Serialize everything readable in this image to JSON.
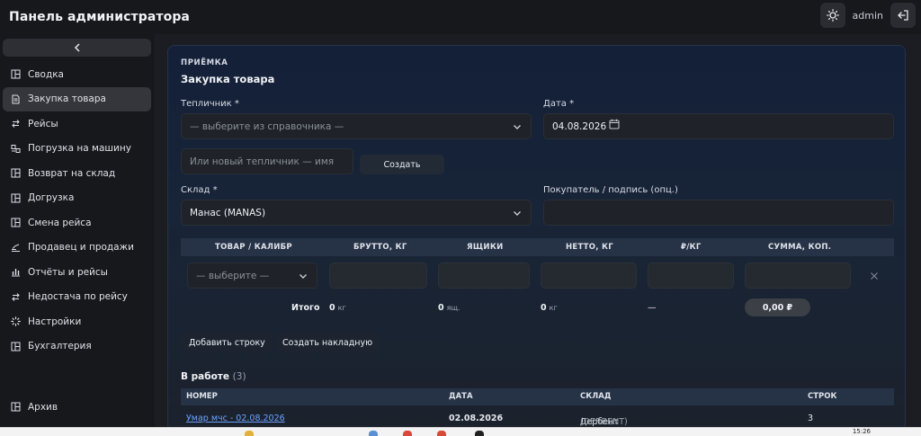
{
  "header": {
    "title": "Панель администратора",
    "user": "admin",
    "theme_icon": "sun-icon",
    "logout_icon": "logout-icon"
  },
  "sidebar": {
    "collapse_icon": "chevron-left-icon",
    "items": [
      {
        "label": "Сводка",
        "icon": "layout-icon",
        "active": false
      },
      {
        "label": "Закупка товара",
        "icon": "document-icon",
        "active": true
      },
      {
        "label": "Рейсы",
        "icon": "swap-icon",
        "active": false
      },
      {
        "label": "Погрузка на машину",
        "icon": "truck-load-icon",
        "active": false
      },
      {
        "label": "Возврат на склад",
        "icon": "layout-icon",
        "active": false
      },
      {
        "label": "Догрузка",
        "icon": "layout-icon",
        "active": false
      },
      {
        "label": "Смена рейса",
        "icon": "layout-icon",
        "active": false
      },
      {
        "label": "Продавец и продажи",
        "icon": "scale-icon",
        "active": false
      },
      {
        "label": "Отчёты и рейсы",
        "icon": "bar-chart-icon",
        "active": false
      },
      {
        "label": "Недостача по рейсу",
        "icon": "swap-icon",
        "active": false
      },
      {
        "label": "Настройки",
        "icon": "settings-icon",
        "active": false
      },
      {
        "label": "Бухгалтерия",
        "icon": "layout-icon",
        "active": false
      }
    ],
    "archive": {
      "label": "Архив",
      "icon": "layout-icon"
    }
  },
  "form": {
    "eyebrow": "ПРИЁМКА",
    "title": "Закупка товара",
    "greenhouse_label": "Тепличник *",
    "greenhouse_placeholder": "— выберите из справочника —",
    "date_label": "Дата *",
    "date_value": "04.08.2026",
    "new_greenhouse_placeholder": "Или новый тепличник — имя",
    "create_button": "Создать",
    "warehouse_label": "Склад *",
    "warehouse_value": "Манас (MANAS)",
    "buyer_label": "Покупатель / подпись (опц.)",
    "buyer_value": ""
  },
  "items_table": {
    "columns": [
      "ТОВАР / КАЛИБР",
      "БРУТТО, КГ",
      "ЯЩИКИ",
      "НЕТТО, КГ",
      "₽/КГ",
      "СУММА, КОП."
    ],
    "row_select_placeholder": "— выберите —",
    "total_label": "Итого",
    "total_gross": "0",
    "total_gross_unit": "кг",
    "total_boxes": "0",
    "total_boxes_unit": "ящ.",
    "total_net": "0",
    "total_net_unit": "кг",
    "total_price": "—",
    "total_sum": "0,00 ₽"
  },
  "actions": {
    "add_row": "Добавить строку",
    "create_invoice": "Создать накладную"
  },
  "in_work": {
    "title": "В работе",
    "count": "(3)",
    "columns": [
      "НОМЕР",
      "ДАТА",
      "СКЛАД",
      "СТРОК"
    ],
    "rows": [
      {
        "number": "Умар мчс - 02.08.2026",
        "date": "02.08.2026",
        "warehouse": "Дербент",
        "warehouse_code": "(DERBENT)",
        "lines": "3"
      }
    ]
  },
  "taskbar": {
    "clock": "15:26"
  }
}
